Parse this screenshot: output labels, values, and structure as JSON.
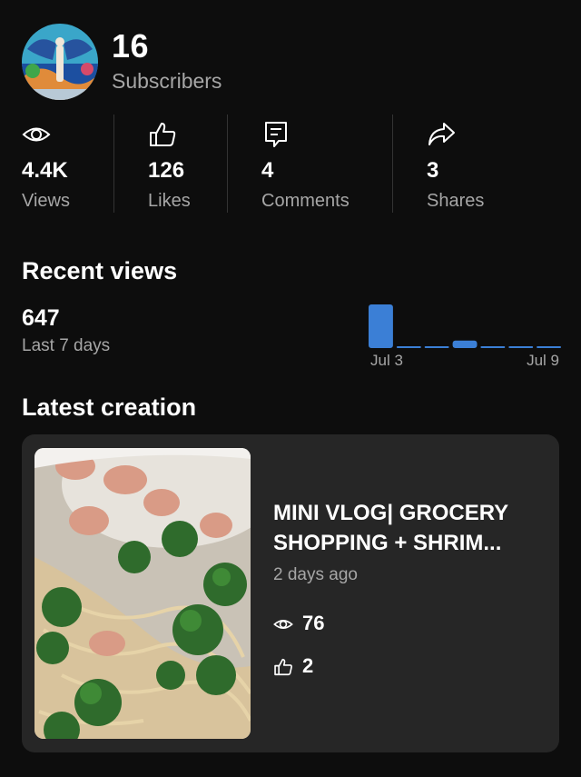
{
  "header": {
    "subscriber_count": "16",
    "subscriber_label": "Subscribers"
  },
  "stats": [
    {
      "icon": "eye-icon",
      "value": "4.4K",
      "label": "Views"
    },
    {
      "icon": "thumbs-up-icon",
      "value": "126",
      "label": "Likes"
    },
    {
      "icon": "comment-icon",
      "value": "4",
      "label": "Comments"
    },
    {
      "icon": "share-icon",
      "value": "3",
      "label": "Shares"
    }
  ],
  "recent_views": {
    "title": "Recent views",
    "count": "647",
    "period": "Last 7 days",
    "chart_start_label": "Jul 3",
    "chart_end_label": "Jul 9",
    "bar_relative_heights": [
      1.0,
      0.04,
      0.04,
      0.17,
      0.04,
      0.04,
      0.04
    ],
    "bar_color": "#3b7fd6"
  },
  "latest": {
    "title": "Latest creation",
    "video_title_line1": "MINI VLOG| GROCERY",
    "video_title_line2": "SHOPPING + SHRIM...",
    "age": "2 days ago",
    "views": "76",
    "likes": "2"
  }
}
